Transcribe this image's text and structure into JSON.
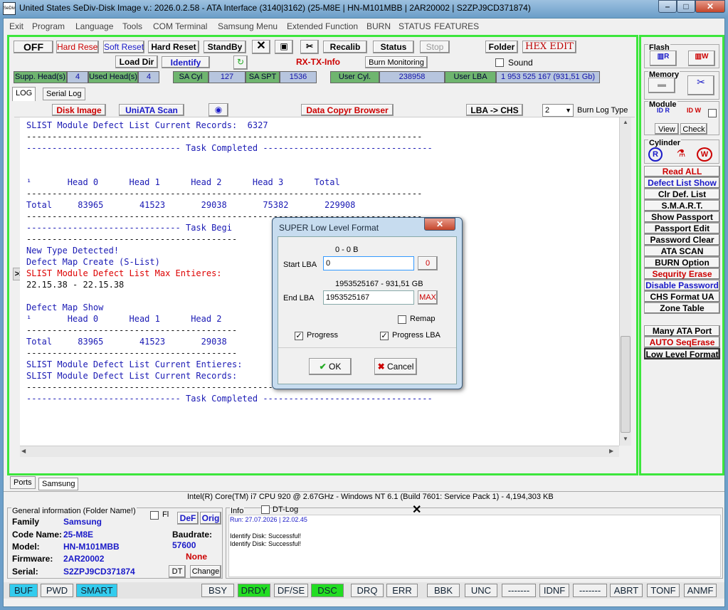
{
  "window": {
    "icon_text": "SeDiv",
    "title": "United States  SeDiv-Disk Image v.: 2026.0.2.58 - ATA Interface (3140|3162)  (25-M8E | HN-M101MBB | 2AR20002 | S2ZPJ9CD371874)",
    "min": "–",
    "max": "□",
    "close": "✕"
  },
  "menu": [
    "Exit",
    "Program",
    "Language",
    "Tools",
    "COM Terminal",
    "Samsung Menu",
    "Extended Function",
    "BURN",
    "STATUS",
    "FEATURES"
  ],
  "toolbar": {
    "off": "OFF",
    "hard_reset_r": "Hard Reset",
    "soft_reset": "Soft Reset",
    "hard_reset": "Hard Reset",
    "standby": "StandBy",
    "recalib": "Recalib",
    "status": "Status",
    "stop": "Stop",
    "folder": "Folder",
    "hex_edit": "HEX EDIT",
    "load_dir": "Load Dir",
    "identify": "Identify",
    "rx_tx": "RX-TX-Info",
    "burn_monitoring": "Burn Monitoring",
    "sound": "Sound"
  },
  "geometry": {
    "supp_heads_label": "Supp. Head(s)",
    "supp_heads": "4",
    "used_heads_label": "Used Head(s)",
    "used_heads": "4",
    "sa_cyl_label": "SA Cyl",
    "sa_cyl": "127",
    "sa_spt_label": "SA SPT",
    "sa_spt": "1536",
    "user_cyl_label": "User Cyl.",
    "user_cyl": "238958",
    "user_lba_label": "User LBA",
    "user_lba": "1 953 525 167   (931,51 Gb)"
  },
  "tabs": {
    "log": "LOG",
    "serial_log": "Serial Log"
  },
  "logbar": {
    "disk_image": "Disk Image",
    "uniata_scan": "UniATA Scan",
    "data_copyr": "Data Copyr Browser",
    "lba_chs": "LBA -> CHS",
    "burn_val": "2",
    "burn_log_type": "Burn Log Type",
    "nav": ">>"
  },
  "log_lines": [
    {
      "t": "SLIST Module Defect List Current Records:  6327",
      "c": ""
    },
    {
      "t": "-----------------------------------------------------------------------------",
      "c": "k"
    },
    {
      "t": "------------------------------ Task Completed ---------------------------------",
      "c": ""
    },
    {
      "t": "",
      "c": ""
    },
    {
      "t": "",
      "c": ""
    },
    {
      "t": "¹       Head 0      Head 1      Head 2      Head 3      Total",
      "c": ""
    },
    {
      "t": "-----------------------------------------------------------------------------",
      "c": "k"
    },
    {
      "t": "Total     83965       41523       29038       75382       229908",
      "c": ""
    },
    {
      "t": "-----------------------------------------------------------------------------",
      "c": "k"
    },
    {
      "t": "------------------------------ Task Begi",
      "c": ""
    },
    {
      "t": "-----------------------------------------",
      "c": "k"
    },
    {
      "t": "New Type Detected!",
      "c": ""
    },
    {
      "t": "Defect Map Create (S-List)",
      "c": ""
    },
    {
      "t": "SLIST Module Defect List Max Entieres:",
      "c": "r"
    },
    {
      "t": "22.15.38 - 22.15.38",
      "c": "k"
    },
    {
      "t": "",
      "c": ""
    },
    {
      "t": "Defect Map Show",
      "c": ""
    },
    {
      "t": "¹       Head 0      Head 1      Head 2",
      "c": ""
    },
    {
      "t": "-----------------------------------------",
      "c": "k"
    },
    {
      "t": "Total     83965       41523       29038",
      "c": ""
    },
    {
      "t": "-----------------------------------------",
      "c": "k"
    },
    {
      "t": "SLIST Module Defect List Current Entieres:",
      "c": ""
    },
    {
      "t": "SLIST Module Defect List Current Records:",
      "c": ""
    },
    {
      "t": "-----------------------------------------------------------------------------",
      "c": "k"
    },
    {
      "t": "------------------------------ Task Completed ---------------------------------",
      "c": ""
    }
  ],
  "sidebar": {
    "flash": "Flash",
    "memory": "Memory",
    "module": "Module",
    "view": "View",
    "check": "Check",
    "cylinder": "Cylinder",
    "buttons": [
      {
        "label": "Read ALL",
        "color": "#c00"
      },
      {
        "label": "Defect List Show",
        "color": "#1a1ac8"
      },
      {
        "label": "Clr Def. List",
        "color": "#000"
      },
      {
        "label": "S.M.A.R.T.",
        "color": "#000"
      },
      {
        "label": "Show Passport",
        "color": "#000"
      },
      {
        "label": "Passport Edit",
        "color": "#000"
      },
      {
        "label": "Password Clear",
        "color": "#000"
      },
      {
        "label": "ATA SCAN",
        "color": "#000"
      },
      {
        "label": "BURN Option",
        "color": "#000"
      },
      {
        "label": "Sequrity Erase",
        "color": "#c00"
      },
      {
        "label": "Disable Password",
        "color": "#1a1ac8"
      },
      {
        "label": "CHS Format UA",
        "color": "#000"
      },
      {
        "label": "Zone Table",
        "color": "#000"
      }
    ],
    "buttons2": [
      {
        "label": "Many ATA Port",
        "color": "#000"
      },
      {
        "label": "AUTO SeqErase",
        "color": "#c00"
      },
      {
        "label": "Low Level Format",
        "color": "#000"
      }
    ]
  },
  "dialog": {
    "title": "SUPER Low Level Format",
    "start_info": "0 - 0 B",
    "start_label": "Start LBA",
    "start_value": "0",
    "start_btn": "0",
    "end_info": "1953525167 - 931,51 GB",
    "end_label": "End LBA",
    "end_value": "1953525167",
    "max_btn": "MAX",
    "remap": "Remap",
    "progress": "Progress",
    "progress_lba": "Progress LBA",
    "ok": "OK",
    "cancel": "Cancel"
  },
  "bottom_tabs": {
    "ports": "Ports",
    "samsung": "Samsung"
  },
  "sysinfo": "Intel(R) Core(TM) i7 CPU 920  @ 2.67GHz - Windows NT 6.1 (Build 7601: Service Pack 1) -  4,194,303 KB",
  "general": {
    "title": "General information (Folder Name!)",
    "fl": "Fl",
    "def": "DeF",
    "orig": "Orig",
    "family_label": "Family",
    "family": "Samsung",
    "code_label": "Code Name:",
    "code": "25-M8E",
    "model_label": "Model:",
    "model": "HN-M101MBB",
    "firmware_label": "Firmware:",
    "firmware": "2AR20002",
    "serial_label": "Serial:",
    "serial": "S2ZPJ9CD371874",
    "baud_label": "Baudrate:",
    "baud": "57600",
    "none": "None",
    "dt": "DT",
    "change": "Change"
  },
  "info": {
    "title": "Info",
    "dt_log": "DT-Log",
    "run": "Run: 27.07.2026  |  22.02.45",
    "line1": "Identify Disk: Successful!",
    "line2": "Identify Disk: Successful!"
  },
  "status": [
    {
      "label": "BUF",
      "bg": "#33ccee"
    },
    {
      "label": "PWD",
      "bg": "#f0f0f0"
    },
    {
      "label": "SMART",
      "bg": "#33ccee"
    },
    {
      "label": "BSY",
      "bg": "#f0f0f0"
    },
    {
      "label": "DRDY",
      "bg": "#22dd22"
    },
    {
      "label": "DF/SE",
      "bg": "#f0f0f0"
    },
    {
      "label": "DSC",
      "bg": "#22dd22"
    },
    {
      "label": "DRQ",
      "bg": "#f0f0f0"
    },
    {
      "label": "ERR",
      "bg": "#f0f0f0"
    },
    {
      "label": "BBK",
      "bg": "#f0f0f0"
    },
    {
      "label": "UNC",
      "bg": "#f0f0f0"
    },
    {
      "label": "-------",
      "bg": "#f0f0f0"
    },
    {
      "label": "IDNF",
      "bg": "#f0f0f0"
    },
    {
      "label": "-------",
      "bg": "#f0f0f0"
    },
    {
      "label": "ABRT",
      "bg": "#f0f0f0"
    },
    {
      "label": "TONF",
      "bg": "#f0f0f0"
    },
    {
      "label": "ANMF",
      "bg": "#f0f0f0"
    }
  ]
}
